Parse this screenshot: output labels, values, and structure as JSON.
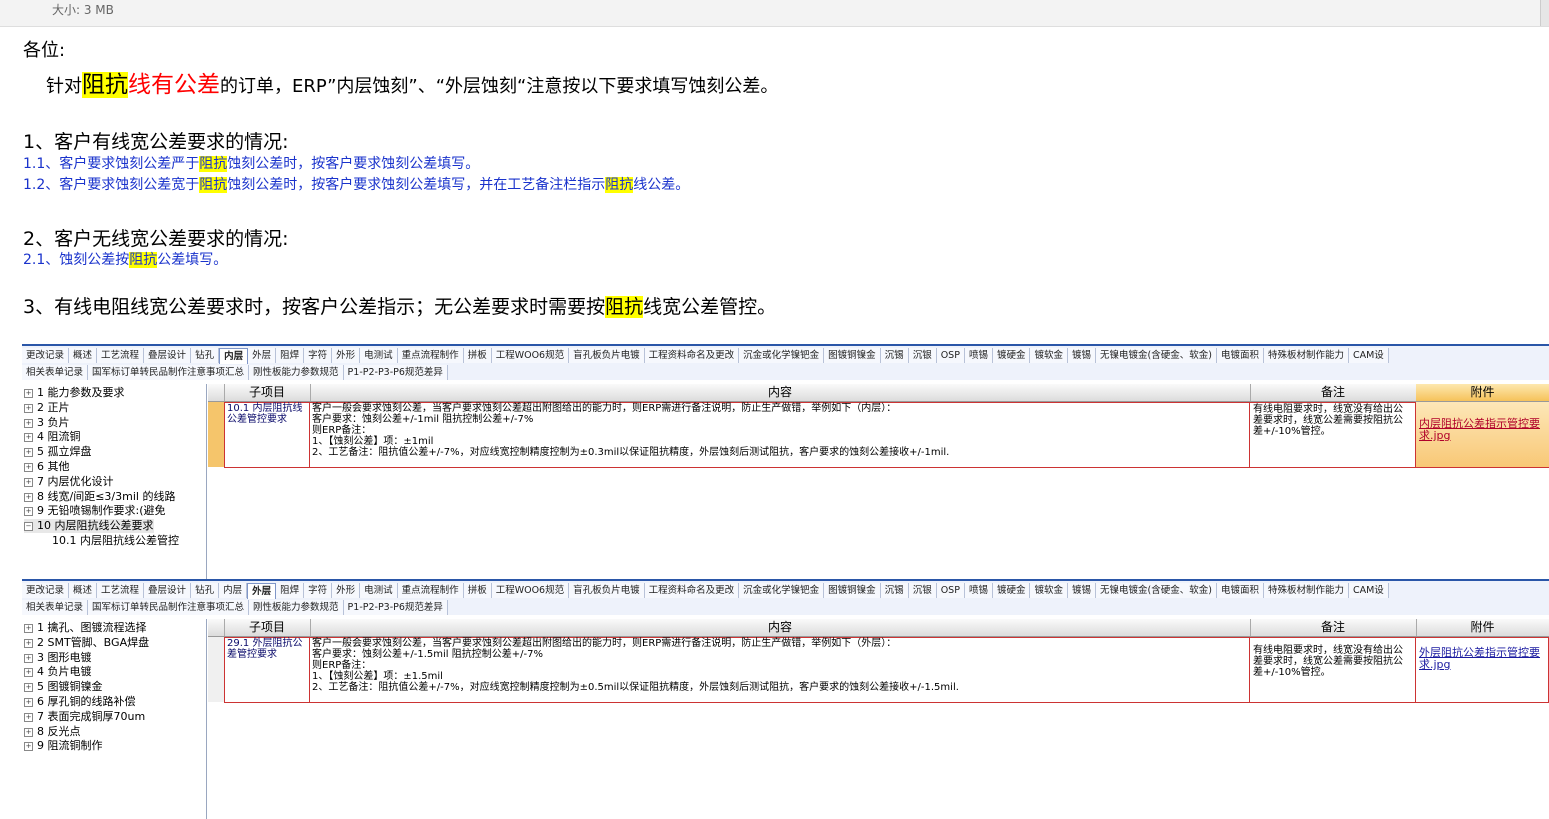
{
  "attachment_size": "大小: 3 MB",
  "email": {
    "greeting": "各位:",
    "intro": {
      "pre": "针对",
      "hl1": "阻抗",
      "red": "线有公差",
      "post": "的订单，ERP”内层蚀刻”、“外层蚀刻“注意按以下要求填写蚀刻公差。"
    },
    "h1": "1、客户有线宽公差要求的情况:",
    "s1": {
      "pre": "1.1、客户要求蚀刻公差严于",
      "hl": "阻抗",
      "post": "蚀刻公差时，按客户要求蚀刻公差填写。"
    },
    "s2": {
      "pre": "1.2、客户要求蚀刻公差宽于",
      "hl": "阻抗",
      "mid": "蚀刻公差时，按客户要求蚀刻公差填写，并在工艺备注栏指示",
      "hl2": "阻抗",
      "post": "线公差。"
    },
    "h2": "2、客户无线宽公差要求的情况:",
    "s3": {
      "pre": "2.1、蚀刻公差按",
      "hl": "阻抗",
      "post": "公差填写。"
    },
    "h3": {
      "pre": "3、有线电阻线宽公差要求时，按客户公差指示；无公差要求时需要按",
      "hl": "阻抗",
      "post": "线宽公差管控。"
    }
  },
  "tabs_row1": [
    "更改记录",
    "概述",
    "工艺流程",
    "叠层设计",
    "钻孔",
    "内层",
    "外层",
    "阻焊",
    "字符",
    "外形",
    "电测试",
    "重点流程制作",
    "拼板",
    "工程WOO6规范",
    "盲孔板负片电镀",
    "工程资料命名及更改",
    "沉金或化学镍钯金",
    "图镀铜镍金",
    "沉锡",
    "沉银",
    "OSP",
    "喷锡",
    "镀硬金",
    "镀软金",
    "镀锡",
    "无镍电镀金(含硬金、软金)",
    "电镀面积",
    "特殊板材制作能力",
    "CAM设"
  ],
  "tabs_row2": [
    "相关表单记录",
    "国军标订单转民品制作注意事项汇总",
    "刚性板能力参数规范",
    "P1-P2-P3-P6规范差异"
  ],
  "panel1": {
    "active_tab": "内层",
    "tree": [
      "1 能力参数及要求",
      "2 正片",
      "3 负片",
      "4 阻流铜",
      "5 孤立焊盘",
      "6 其他",
      "7 内层优化设计",
      "8 线宽/间距≤3/3mil 的线路",
      "9 无铅喷锡制作要求:(避免",
      "10 内层阻抗线公差要求"
    ],
    "tree_child": "10.1 内层阻抗线公差管控",
    "headers": [
      "子项目",
      "内容",
      "备注",
      "附件"
    ],
    "row": {
      "sub": "10.1 内层阻抗线公差管控要求",
      "content": [
        "客户一般会要求蚀刻公差，当客户要求蚀刻公差超出附图给出的能力时，则ERP需进行备注说明，防止生产做错，举例如下（内层）：",
        "客户要求：蚀刻公差+/-1mil  阻抗控制公差+/-7%",
        "则ERP备注：",
        "1、【蚀刻公差】项：±1mil",
        "2、工艺备注：阻抗值公差+/-7%，对应线宽控制精度控制为±0.3mil以保证阻抗精度，外层蚀刻后测试阻抗，客户要求的蚀刻公差接收+/-1mil."
      ],
      "note": "有线电阻要求时，线宽没有给出公差要求时，线宽公差需要按阻抗公差+/-10%管控。",
      "attachment": "内层阻抗公差指示管控要求.jpg"
    }
  },
  "panel2": {
    "active_tab": "外层",
    "tree": [
      "1 擒孔、图镀流程选择",
      "2 SMT管脚、BGA焊盘",
      "3 图形电镀",
      "4 负片电镀",
      "5 图镀铜镍金",
      "6 厚孔铜的线路补偿",
      "7 表面完成铜厚70um",
      "8 反光点",
      "9 阻流铜制作"
    ],
    "headers": [
      "子项目",
      "内容",
      "备注",
      "附件"
    ],
    "row": {
      "sub": "29.1 外层阻抗公差管控要求",
      "content": [
        "客户一般会要求蚀刻公差，当客户要求蚀刻公差超出附图给出的能力时，则ERP需进行备注说明，防止生产做错，举例如下（外层）：",
        "客户要求：蚀刻公差+/-1.5mil  阻抗控制公差+/-7%",
        "则ERP备注：",
        "1、【蚀刻公差】项：±1.5mil",
        "2、工艺备注：阻抗值公差+/-7%，对应线宽控制精度控制为±0.5mil以保证阻抗精度，外层蚀刻后测试阻抗，客户要求的蚀刻公差接收+/-1.5mil."
      ],
      "note": "有线电阻要求时，线宽没有给出公差要求时，线宽公差需要按阻抗公差+/-10%管控。",
      "attachment": "外层阻抗公差指示管控要求.jpg"
    }
  }
}
